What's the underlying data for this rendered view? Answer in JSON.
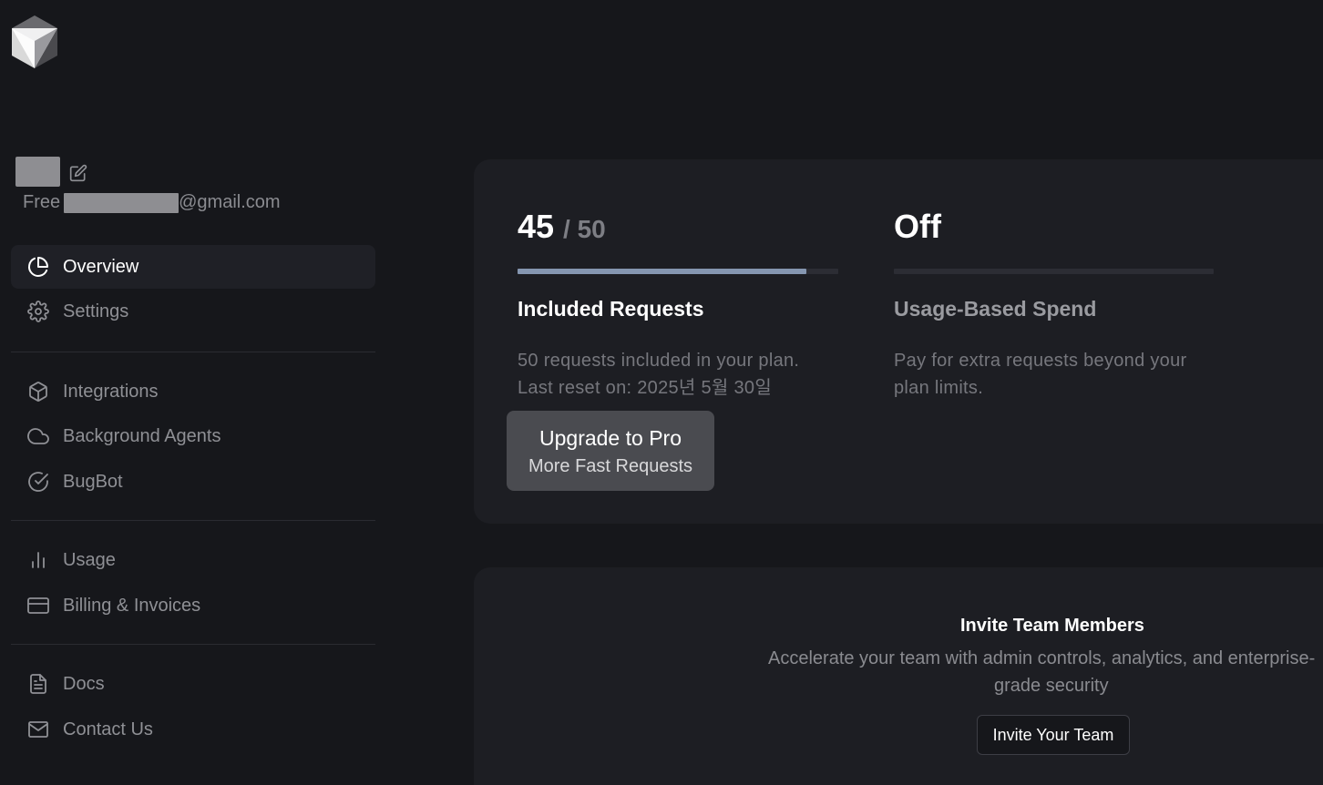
{
  "app": {
    "logo_icon": "cube-logo-icon"
  },
  "user": {
    "plan": "Free",
    "email_suffix": "@gmail.com"
  },
  "sidebar": {
    "items": [
      {
        "label": "Overview",
        "icon": "pie-chart-icon",
        "active": true
      },
      {
        "label": "Settings",
        "icon": "gear-icon",
        "active": false
      },
      {
        "label": "Integrations",
        "icon": "cube-icon",
        "active": false
      },
      {
        "label": "Background Agents",
        "icon": "cloud-icon",
        "active": false
      },
      {
        "label": "BugBot",
        "icon": "check-circle-icon",
        "active": false
      },
      {
        "label": "Usage",
        "icon": "bar-chart-icon",
        "active": false
      },
      {
        "label": "Billing & Invoices",
        "icon": "credit-card-icon",
        "active": false
      },
      {
        "label": "Docs",
        "icon": "document-icon",
        "active": false
      },
      {
        "label": "Contact Us",
        "icon": "mail-icon",
        "active": false
      }
    ]
  },
  "usage": {
    "included": {
      "used": "45",
      "limit": "/ 50",
      "progress_fraction": 0.9,
      "title": "Included Requests",
      "desc_line1": "50 requests included in your plan.",
      "desc_line2": "Last reset on: 2025년 5월 30일"
    },
    "usage_based": {
      "status": "Off",
      "progress_fraction": 0,
      "title": "Usage-Based Spend",
      "desc_line1": "Pay for extra requests beyond your",
      "desc_line2": "plan limits."
    },
    "upgrade_button": {
      "line1": "Upgrade to Pro",
      "line2": "More Fast Requests"
    }
  },
  "team": {
    "title": "Invite Team Members",
    "desc_line1": "Accelerate your team with admin controls, analytics, and enterprise-",
    "desc_line2": "grade security",
    "button_label": "Invite Your Team"
  },
  "colors": {
    "background": "#16171b",
    "card": "#1d1e23",
    "progress_fill": "#8596b0",
    "active_nav": "#1f2026"
  }
}
